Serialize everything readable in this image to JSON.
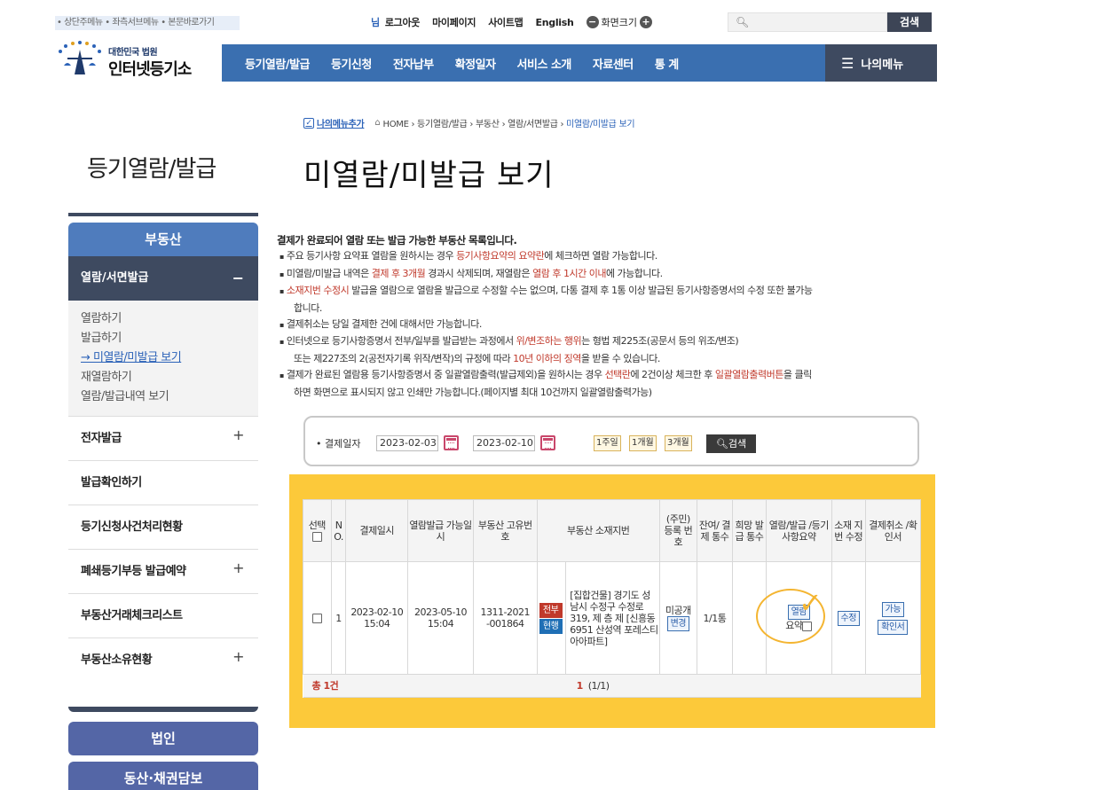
{
  "skip_links": "• 상단주메뉴 • 좌측서브메뉴 • 본문바로가기",
  "topbar": {
    "user_suffix": "님",
    "logout": "로그아웃",
    "mypage": "마이페이지",
    "sitemap": "사이트맵",
    "english": "English",
    "zoom_label": "화면크기",
    "zoom_minus": "−",
    "zoom_plus": "+",
    "search_placeholder": "",
    "search_button": "검색"
  },
  "logo": {
    "line1": "대한민국 법원",
    "line2": "인터넷등기소"
  },
  "gnb": {
    "items": [
      "등기열람/발급",
      "등기신청",
      "전자납부",
      "확정일자",
      "서비스 소개",
      "자료센터",
      "통 계"
    ],
    "mymenu": "나의메뉴"
  },
  "breadcrumb": {
    "add": "나의메뉴추가",
    "path": "HOME › 등기열람/발급 › 부동산 › 열람/서면발급 ›",
    "current": "미열람/미발급 보기"
  },
  "lnb": {
    "title": "등기열람/발급",
    "category": "부동산",
    "selected": "열람/서면발급",
    "selected_mark": "−",
    "sub_items": [
      "열람하기",
      "발급하기",
      "→ 미열람/미발급 보기",
      "재열람하기",
      "열람/발급내역 보기"
    ],
    "rows": [
      {
        "label": "전자발급",
        "plus": "+"
      },
      {
        "label": "발급확인하기",
        "plus": ""
      },
      {
        "label": "등기신청사건처리현황",
        "plus": ""
      },
      {
        "label": "폐쇄등기부등 발급예약",
        "plus": "+"
      },
      {
        "label": "부동산거래체크리스트",
        "plus": ""
      },
      {
        "label": "부동산소유현황",
        "plus": "+"
      }
    ],
    "buttons": [
      "법인",
      "동산·채권담보"
    ]
  },
  "page_title": "미열람/미발급 보기",
  "notice": {
    "head": "결제가 완료되어 열람 또는 발급 가능한 부동산 목록입니다.",
    "l1a": "주요 등기사항 요약표 열람을 원하시는 경우 ",
    "l1r": "등기사항요약의 요약란",
    "l1b": "에 체크하면 열람 가능합니다.",
    "l2a": "미열람/미발급 내역은 ",
    "l2r": "결제 후 3개월",
    "l2b": " 경과시 삭제되며, 재열람은 ",
    "l2r2": "열람 후 1시간 이내",
    "l2c": "에 가능합니다.",
    "l3r": "소재지번 수정시",
    "l3a": " 발급을 열람으로 열람을 발급으로 수정할 수는 없으며, 다통 결제 후 1통 이상 발급된 등기사항증명서의 수정 또한 불가능",
    "l3b": "합니다.",
    "l4": "결제취소는 당일 결제한 건에 대해서만 가능합니다.",
    "l5a": "인터넷으로 등기사항증명서 전부/일부를 발급받는 과정에서 ",
    "l5r": "위/변조하는 행위",
    "l5b": "는 형법 제225조(공문서 등의 위조/변조)",
    "l5c": "또는 제227조의 2(공전자기록 위작/변작)의 규정에 따라 ",
    "l5r2": "10년 이하의 징역",
    "l5d": "을 받을 수 있습니다.",
    "l6a": "결제가 완료된 열람용 등기사항증명서 중 일괄열람출력(발급제외)을 원하시는 경우 ",
    "l6r": "선택란",
    "l6b": "에 2건이상 체크한 후 ",
    "l6r2": "일괄열람출력버튼",
    "l6c": "을 클릭",
    "l6d": "하면 화면으로 표시되지 않고 인쇄만 가능합니다.(페이지별 최대 10건까지 일괄열람출력가능)"
  },
  "filter": {
    "label": "• 결제일자",
    "from": "2023-02-03",
    "tilde": "~",
    "to": "2023-02-10",
    "periods": [
      "1주일",
      "1개월",
      "3개월"
    ],
    "search": "검색"
  },
  "table": {
    "headers": {
      "select": "선택",
      "no": "N O.",
      "paid_at": "결제일시",
      "available_at": "열람발급 가능일시",
      "unique_no": "부동산 고유번호",
      "address": "부동산 소재지번",
      "reg_no": "(주민) 등록 번호",
      "remaining": "잔여/ 결제 통수",
      "hope": "희망 발급 통수",
      "view_issue": "열람/발급 /등기 사항요약",
      "address_edit": "소재 지번 수정",
      "cancel": "결제취소 /확인서"
    },
    "row": {
      "no": "1",
      "paid_date": "2023-02-10",
      "paid_time": "15:04",
      "avail_date": "2023-05-10",
      "avail_time": "15:04",
      "unique_no_1": "1311-2021",
      "unique_no_2": "-001864",
      "tag_all": "전부",
      "tag_current": "현행",
      "address": "[집합건물] 경기도 성남시 수정구 수정로 319, 제 층 제 [신흥동 6951 산성역 포레스티아아파트]",
      "reg_no": "미공개",
      "reg_change": "변경",
      "remaining": "1/1통",
      "view_btn": "열람",
      "summary_label": "요약",
      "edit_btn": "수정",
      "cancel_btn": "가능",
      "confirm_btn": "확인서"
    },
    "footer": {
      "total": "총 1건",
      "page": "1",
      "page_info": "(1/1)"
    }
  }
}
